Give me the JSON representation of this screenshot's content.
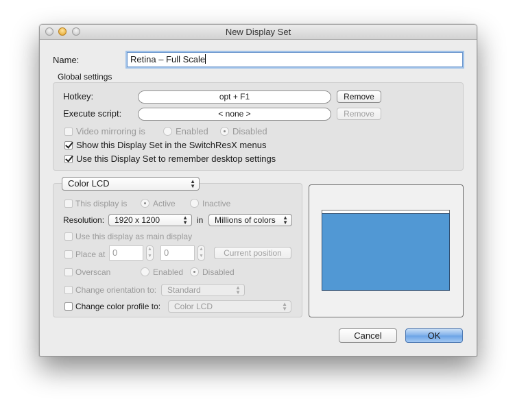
{
  "window": {
    "title": "New Display Set",
    "traffic_lights": [
      "close-button",
      "minimize-button",
      "zoom-button"
    ]
  },
  "name_field": {
    "label": "Name:",
    "value": "Retina – Full Scale"
  },
  "global_settings": {
    "title": "Global settings",
    "hotkey": {
      "label": "Hotkey:",
      "value": "opt + F1",
      "remove_label": "Remove",
      "remove_enabled": true
    },
    "script": {
      "label": "Execute script:",
      "value": "< none >",
      "remove_label": "Remove",
      "remove_enabled": false
    },
    "video_mirroring": {
      "label": "Video mirroring is",
      "checked": false,
      "enabled": false,
      "options": [
        "Enabled",
        "Disabled"
      ],
      "selected": "Disabled"
    },
    "show_in_menus": {
      "label": "Show this Display Set in the SwitchResX menus",
      "checked": true
    },
    "remember_desktop": {
      "label": "Use this Display Set to remember desktop settings",
      "checked": true
    }
  },
  "display": {
    "selected_display": "Color LCD",
    "this_display_is": {
      "label": "This display is",
      "checked": false,
      "options": [
        "Active",
        "Inactive"
      ],
      "selected": "Active"
    },
    "resolution": {
      "label": "Resolution:",
      "value": "1920 x 1200",
      "in_label": "in",
      "colors": "Millions of colors"
    },
    "main_display": {
      "label": "Use this display as main display",
      "checked": false
    },
    "place_at": {
      "label": "Place at",
      "checked": false,
      "x": "0",
      "y": "0",
      "button_label": "Current position"
    },
    "overscan": {
      "label": "Overscan",
      "checked": false,
      "options": [
        "Enabled",
        "Disabled"
      ],
      "selected": "Disabled"
    },
    "orientation": {
      "label": "Change orientation to:",
      "checked": false,
      "value": "Standard"
    },
    "color_profile": {
      "label": "Change color profile to:",
      "checked": false,
      "value": "Color LCD"
    }
  },
  "preview": {
    "screen_color": "#5198d4"
  },
  "footer": {
    "cancel_label": "Cancel",
    "ok_label": "OK"
  }
}
